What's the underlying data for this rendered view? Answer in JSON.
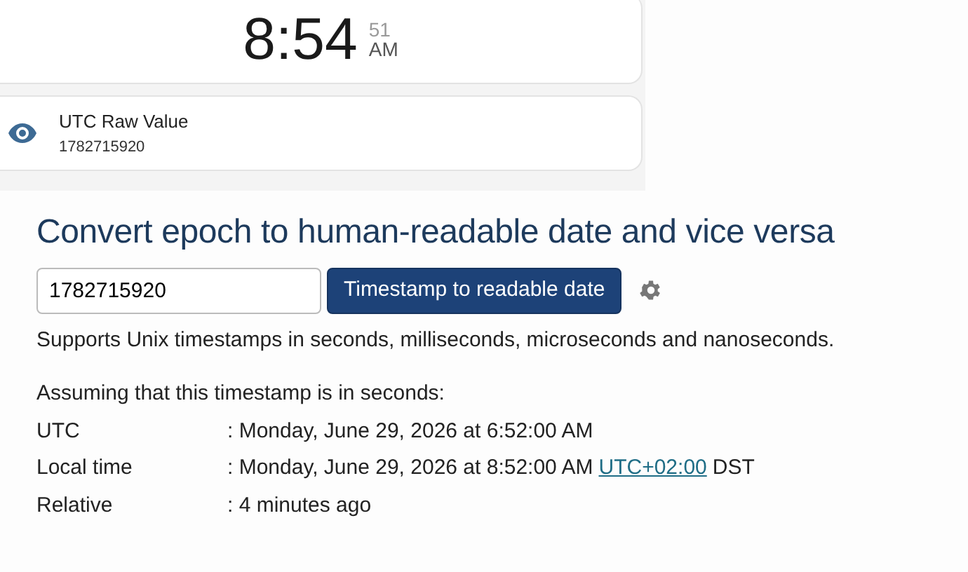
{
  "clock": {
    "time": "8:54",
    "seconds": "51",
    "meridiem": "AM"
  },
  "raw_value": {
    "label": "UTC Raw Value",
    "value": "1782715920"
  },
  "heading": "Convert epoch to human-readable date and vice versa",
  "timestamp_input": {
    "value": "1782715920"
  },
  "convert_button": "Timestamp to readable date",
  "note": "Supports Unix timestamps in seconds, milliseconds, microseconds and nanoseconds.",
  "assumption": "Assuming that this timestamp is in seconds:",
  "results": [
    {
      "label": "UTC",
      "value": ": Monday, June 29, 2026 at 6:52:00 AM"
    },
    {
      "label": "Local time",
      "value": ": Monday, June 29, 2026 at 8:52:00 AM",
      "link": "UTC+02:00",
      "suffix": "DST"
    },
    {
      "label": "Relative",
      "value": ": 4 minutes ago"
    }
  ]
}
